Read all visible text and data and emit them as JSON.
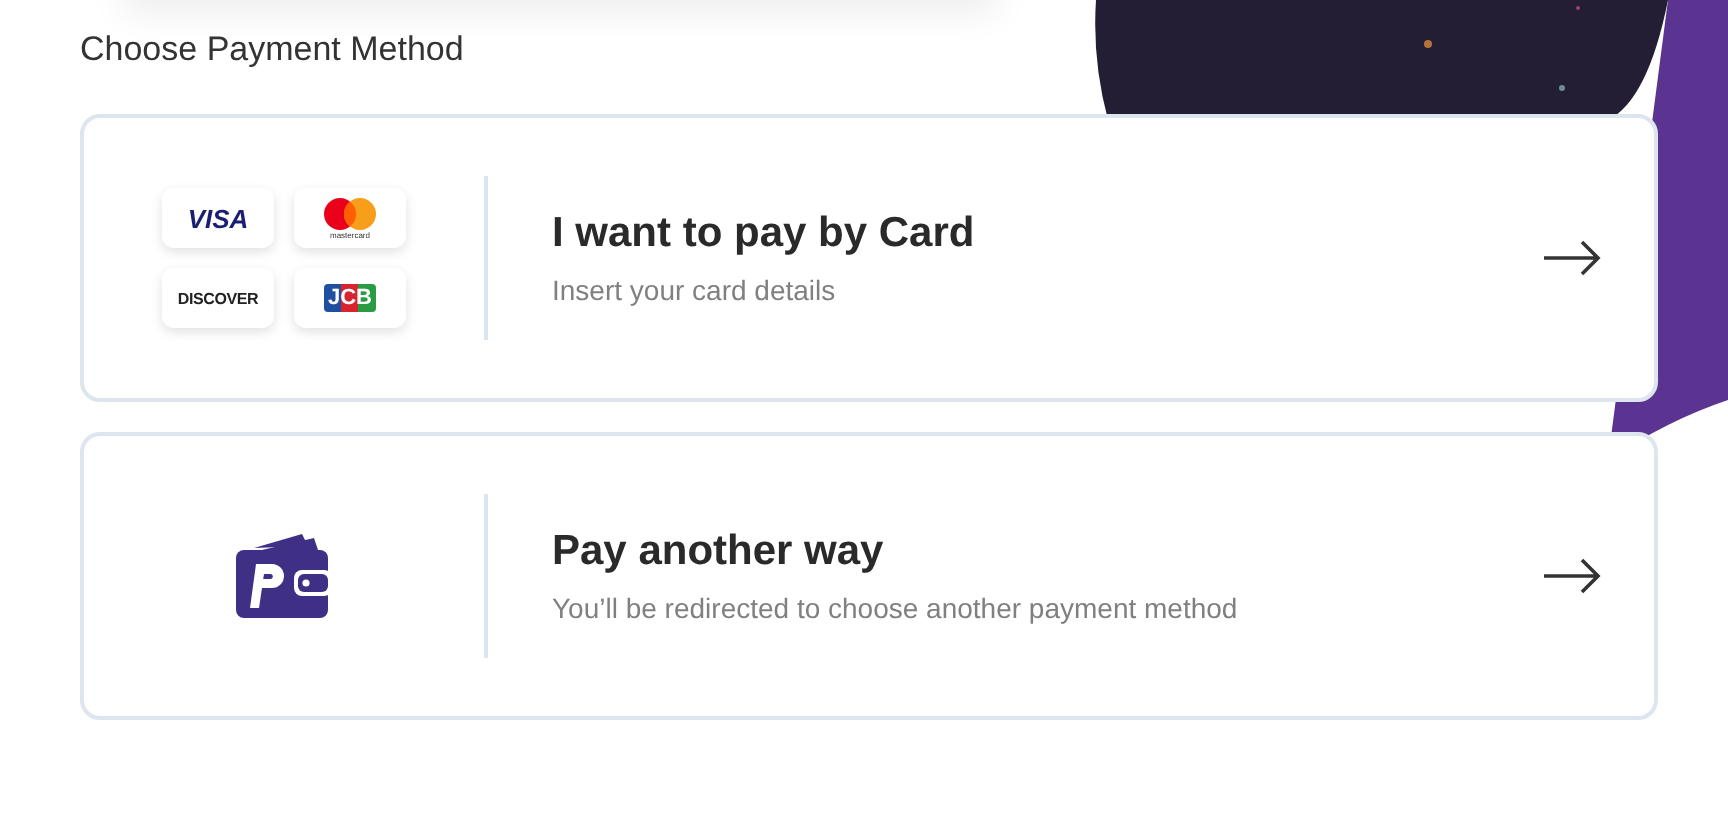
{
  "heading": "Choose Payment Method",
  "options": [
    {
      "kind": "cards",
      "title": "I want to pay by Card",
      "subtitle": "Insert your card details",
      "logos": [
        {
          "kind": "visa",
          "text": "VISA"
        },
        {
          "kind": "mastercard",
          "text": "mastercard"
        },
        {
          "kind": "discover",
          "text": "DISCOVER"
        },
        {
          "kind": "jcb",
          "text": "JCB"
        }
      ]
    },
    {
      "kind": "wallet",
      "title": "Pay another way",
      "subtitle": "You’ll be redirected to choose another payment method"
    }
  ]
}
